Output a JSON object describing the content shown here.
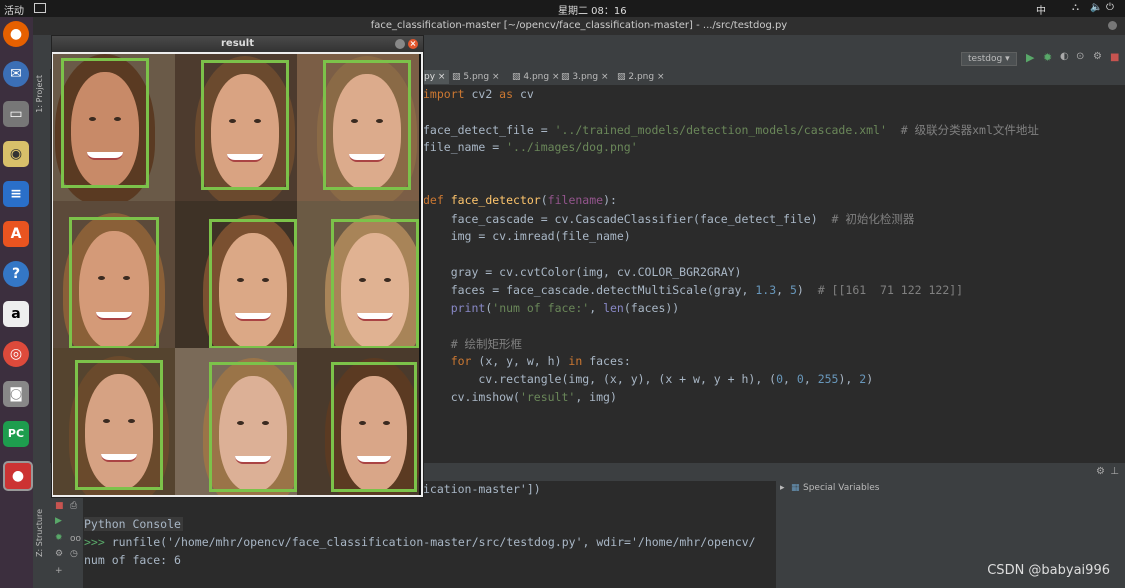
{
  "topbar": {
    "activities": "活动",
    "clock": "星期二 08：16",
    "lang": "中"
  },
  "window_title": "face_classification-master [~/opencv/face_classification-master] - .../src/testdog.py",
  "run_config": "testdog",
  "editor_tabs": [
    "py",
    "5.png",
    "4.png",
    "3.png",
    "2.png"
  ],
  "code_lines": [
    "import cv2 as cv",
    "",
    "face_detect_file = '../trained_models/detection_models/cascade.xml'  # 级联分类器xml文件地址",
    "file_name = '../images/dog.png'",
    "",
    "",
    "def face_detector(filename):",
    "    face_cascade = cv.CascadeClassifier(face_detect_file)  # 初始化检测器",
    "    img = cv.imread(file_name)",
    "",
    "    gray = cv.cvtColor(img, cv.COLOR_BGR2GRAY)",
    "    faces = face_cascade.detectMultiScale(gray, 1.3, 5)  # [[161  71 122 122]]",
    "    print('num of face:', len(faces))",
    "",
    "    # 绘制矩形框",
    "    for (x, y, w, h) in faces:",
    "        cv.rectangle(img, (x, y), (x + w, y + h), (0, 0, 255), 2)",
    "    cv.imshow('result', img)"
  ],
  "console": {
    "line1": "ication-master'])",
    "title": "Python Console",
    "prompt": ">>> ",
    "command": "runfile('/home/mhr/opencv/face_classification-master/src/testdog.py', wdir='/home/mhr/opencv/",
    "output": "num of face: 6"
  },
  "special_variables": "Special Variables",
  "result_window_title": "result",
  "side_labels": {
    "project": "1: Project",
    "structure": "Z: Structure"
  },
  "watermark": "CSDN @babyai996",
  "colors": {
    "rect": "#7cc24a",
    "keyword": "#cc7832",
    "string": "#6a8759"
  }
}
